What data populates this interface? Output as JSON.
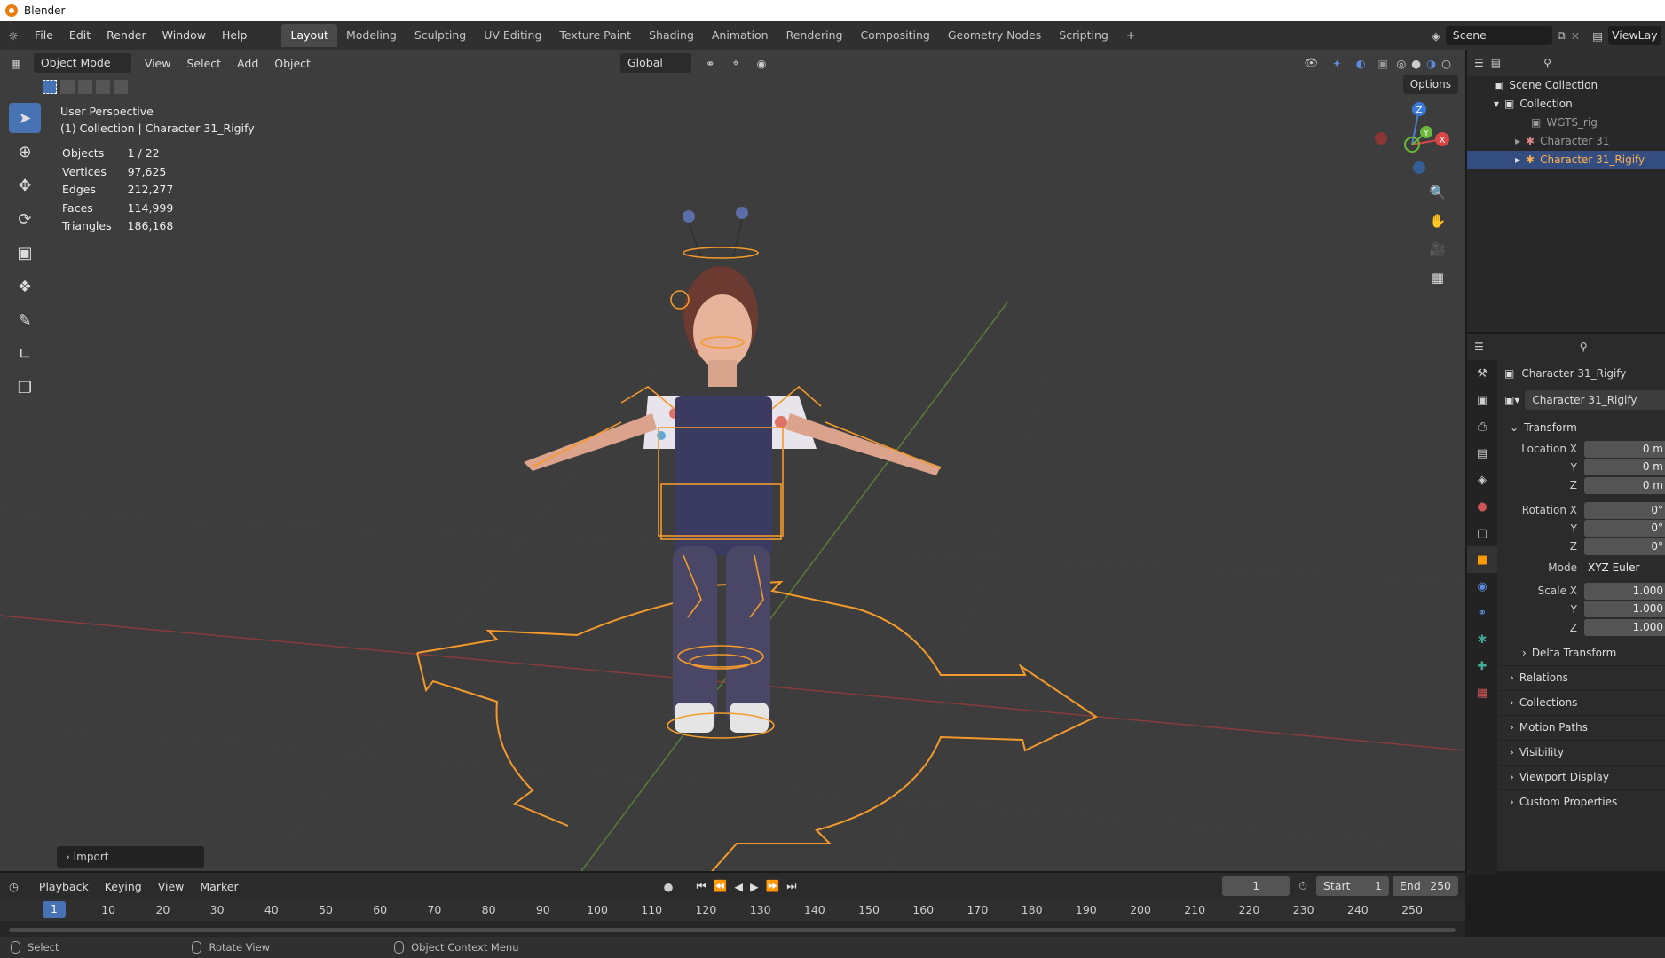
{
  "window": {
    "title": "Blender"
  },
  "menu": {
    "items": [
      "File",
      "Edit",
      "Render",
      "Window",
      "Help"
    ]
  },
  "workspaces": [
    "Layout",
    "Modeling",
    "Sculpting",
    "UV Editing",
    "Texture Paint",
    "Shading",
    "Animation",
    "Rendering",
    "Compositing",
    "Geometry Nodes",
    "Scripting"
  ],
  "add_workspace": "+",
  "scene": {
    "name": "Scene",
    "view_layer": "ViewLay"
  },
  "viewport": {
    "mode": "Object Mode",
    "menus": [
      "View",
      "Select",
      "Add",
      "Object"
    ],
    "orientation": "Global",
    "options_label": "Options",
    "overlay_title": "User Perspective",
    "overlay_subtitle": "(1) Collection | Character 31_Rigify",
    "stats": [
      {
        "label": "Objects",
        "value": "1 / 22"
      },
      {
        "label": "Vertices",
        "value": "97,625"
      },
      {
        "label": "Edges",
        "value": "212,277"
      },
      {
        "label": "Faces",
        "value": "114,999"
      },
      {
        "label": "Triangles",
        "value": "186,168"
      }
    ],
    "import_panel": "Import",
    "gizmo": {
      "z": "Z",
      "y": "Y",
      "x": "X"
    }
  },
  "outliner": {
    "items": [
      {
        "label": "Scene Collection"
      },
      {
        "label": "Collection"
      },
      {
        "label": "WGTS_rig"
      },
      {
        "label": "Character 31"
      },
      {
        "label": "Character 31_Rigify"
      }
    ]
  },
  "properties": {
    "object_name": "Character 31_Rigify",
    "object_field": "Character 31_Rigify",
    "transform_label": "Transform",
    "location": {
      "label": "Location X",
      "x": "0 m",
      "y": "0 m",
      "z": "0 m"
    },
    "rotation": {
      "label": "Rotation X",
      "x": "0°",
      "y": "0°",
      "z": "0°"
    },
    "mode": {
      "label": "Mode",
      "value": "XYZ Euler"
    },
    "scale": {
      "label": "Scale X",
      "x": "1.000",
      "y": "1.000",
      "z": "1.000"
    },
    "axis_y": "Y",
    "axis_z": "Z",
    "delta_transform": "Delta Transform",
    "panels": [
      "Relations",
      "Collections",
      "Motion Paths",
      "Visibility",
      "Viewport Display",
      "Custom Properties"
    ]
  },
  "timeline": {
    "menus": [
      "Playback",
      "Keying",
      "View",
      "Marker"
    ],
    "current_frame": "1",
    "start_label": "Start",
    "start": "1",
    "end_label": "End",
    "end": "250",
    "ticks": [
      "10",
      "20",
      "30",
      "40",
      "50",
      "60",
      "70",
      "80",
      "90",
      "100",
      "110",
      "120",
      "130",
      "140",
      "150",
      "160",
      "170",
      "180",
      "190",
      "200",
      "210",
      "220",
      "230",
      "240",
      "250"
    ],
    "cursor": "1"
  },
  "statusbar": {
    "items": [
      "Select",
      "Rotate View",
      "Object Context Menu"
    ]
  },
  "colors": {
    "accent": "#4772b3",
    "selection": "#ffb04f",
    "rig_outline": "#f39a2b",
    "viewport_bg": "#3d3d3d"
  }
}
